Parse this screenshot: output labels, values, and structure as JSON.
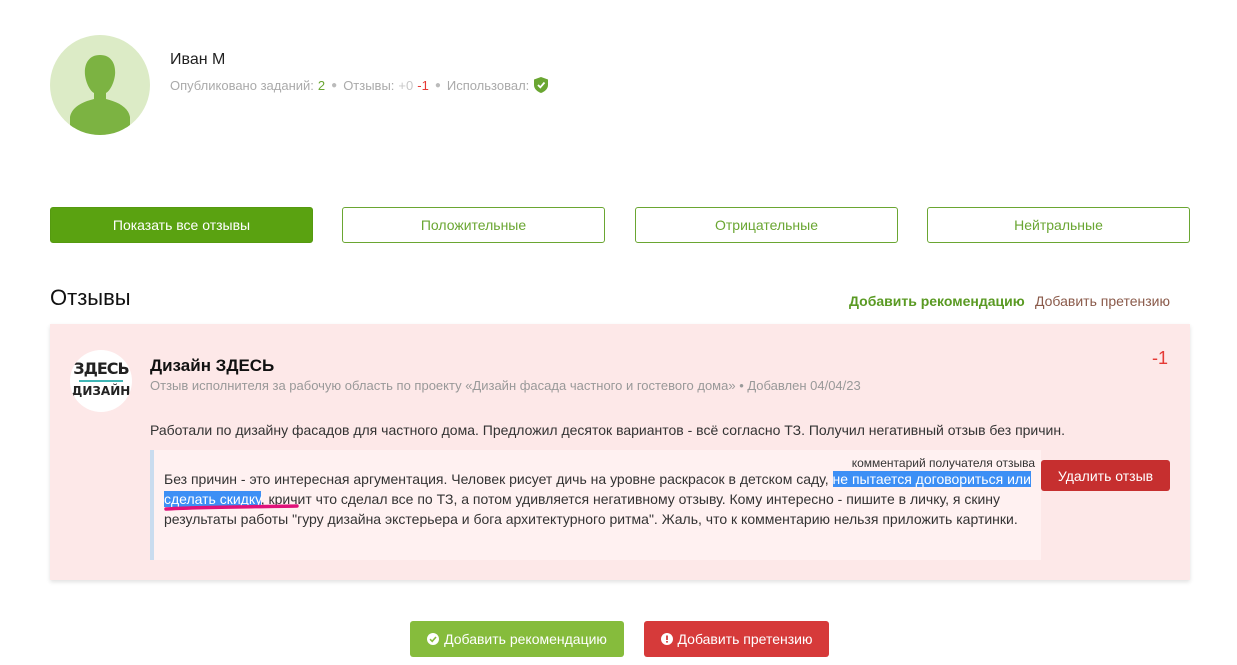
{
  "profile": {
    "name": "Иван М",
    "published_label": "Опубликовано заданий:",
    "published_count": "2",
    "reviews_label": "Отзывы:",
    "reviews_positive": "+0",
    "reviews_negative": "-1",
    "used_label": "Использовал:",
    "used_icon": "shield-icon"
  },
  "filters": {
    "all": "Показать все отзывы",
    "positive": "Положительные",
    "negative": "Отрицательные",
    "neutral": "Нейтральные"
  },
  "section": {
    "title": "Отзывы",
    "add_recommendation": "Добавить рекомендацию",
    "add_claim": "Добавить претензию"
  },
  "review": {
    "logo_top": "ЗДЕСЬ",
    "logo_bottom": "ДИЗАЙН",
    "author": "Дизайн ЗДЕСЬ",
    "meta": "Отзыв исполнителя за рабочую область по проекту «Дизайн фасада частного и гостевого дома» • Добавлен 04/04/23",
    "score": "-1",
    "text": "Работали по дизайну фасадов для частного дома. Предложил десяток вариантов - всё согласно ТЗ. Получил негативный отзыв без причин.",
    "reply": {
      "label": "комментарий получателя отзыва",
      "text_part1": "Без причин - это интересная аргументация. Человек рисует дичь на уровне раскрасок в детском саду, ",
      "text_highlight": "не пытается договориться или сделать скидку",
      "text_part2": ", кричит что сделал все по ТЗ, а потом удивляется негативному отзыву. Кому интересно - пишите в личку, я скину результаты работы \"гуру дизайна экстерьера и бога архитектурного ритма\". Жаль, что к комментарию нельзя приложить картинки."
    },
    "delete_label": "Удалить отзыв"
  },
  "bottom": {
    "add_recommendation": "Добавить рекомендацию",
    "add_claim": "Добавить претензию"
  },
  "colors": {
    "brand_green": "#5aa211",
    "negative_red": "#e53935",
    "card_bg": "#fde8e8",
    "highlight_blue": "#3d8ff5",
    "annotation_pink": "#e0127a"
  }
}
